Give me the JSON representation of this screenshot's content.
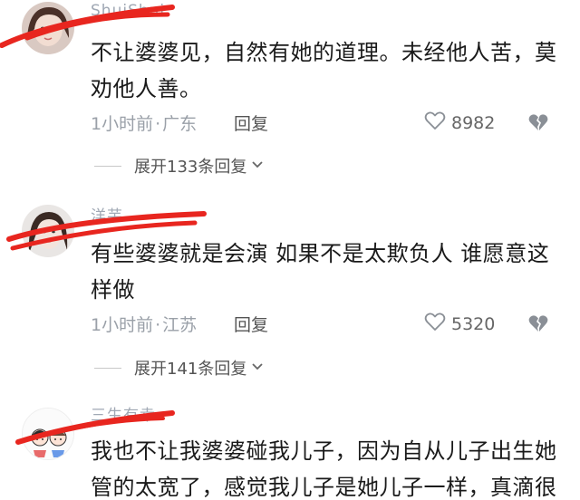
{
  "comments": [
    {
      "username": "ShuiShui",
      "text": "不让婆婆见，自然有她的道理。未经他人苦，莫劝他人善。",
      "time": "1小时前",
      "location": "广东",
      "reply_label": "回复",
      "likes": "8982",
      "expand_label": "展开133条回复"
    },
    {
      "username": "洋芋",
      "text": "有些婆婆就是会演   如果不是太欺负人 谁愿意这样做",
      "time": "1小时前",
      "location": "江苏",
      "reply_label": "回复",
      "likes": "5320",
      "expand_label": "展开141条回复"
    },
    {
      "username": "三生有幸",
      "text": "我也不让我婆婆碰我儿子，因为自从儿子出生她管的太宽了，感觉我儿子是她儿子一样，真滴很"
    }
  ],
  "meta_separator": "·",
  "colors": {
    "redact": "#e8261f",
    "meta": "#9aa0a8",
    "body": "#1a1a1a"
  },
  "icons": {
    "like": "heart-outline-icon",
    "dislike": "broken-heart-icon",
    "expand": "chevron-down-icon"
  }
}
